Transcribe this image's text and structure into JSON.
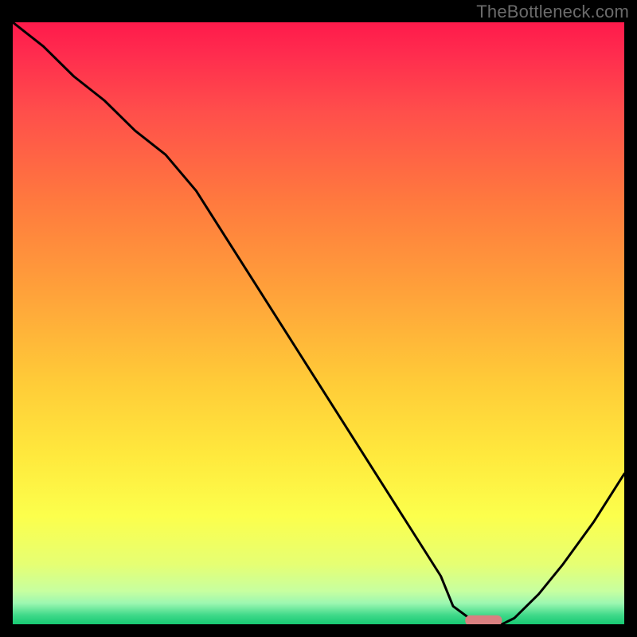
{
  "watermark": "TheBottleneck.com",
  "colors": {
    "frame": "#000000",
    "watermark": "#6b6b6b",
    "gradient_stops": [
      {
        "offset": 0.0,
        "color": "#ff1a4b"
      },
      {
        "offset": 0.05,
        "color": "#ff2b4e"
      },
      {
        "offset": 0.15,
        "color": "#ff4f4b"
      },
      {
        "offset": 0.3,
        "color": "#ff7a3e"
      },
      {
        "offset": 0.45,
        "color": "#ffa23a"
      },
      {
        "offset": 0.6,
        "color": "#ffcc38"
      },
      {
        "offset": 0.72,
        "color": "#ffe93d"
      },
      {
        "offset": 0.82,
        "color": "#fcff4c"
      },
      {
        "offset": 0.9,
        "color": "#e6ff73"
      },
      {
        "offset": 0.945,
        "color": "#c7ffa0"
      },
      {
        "offset": 0.965,
        "color": "#9cf7b1"
      },
      {
        "offset": 0.985,
        "color": "#3fd989"
      },
      {
        "offset": 1.0,
        "color": "#17c973"
      }
    ],
    "curve": "#000000",
    "marker": "#d98081"
  },
  "chart_data": {
    "type": "line",
    "title": "",
    "xlabel": "",
    "ylabel": "",
    "xlim": [
      0,
      100
    ],
    "ylim": [
      0,
      100
    ],
    "legend": false,
    "grid": false,
    "annotations": [],
    "series": [
      {
        "name": "bottleneck-curve",
        "x": [
          0,
          5,
          10,
          15,
          20,
          25,
          30,
          35,
          40,
          45,
          50,
          55,
          60,
          65,
          70,
          72,
          76,
          80,
          82,
          86,
          90,
          95,
          100
        ],
        "values": [
          100,
          96,
          91,
          87,
          82,
          78,
          72,
          64,
          56,
          48,
          40,
          32,
          24,
          16,
          8,
          3,
          0,
          0,
          1,
          5,
          10,
          17,
          25
        ]
      }
    ],
    "marker": {
      "name": "optimal-range-marker",
      "x_start": 74,
      "x_end": 80,
      "y": 0.7,
      "shape": "rounded-bar"
    }
  }
}
